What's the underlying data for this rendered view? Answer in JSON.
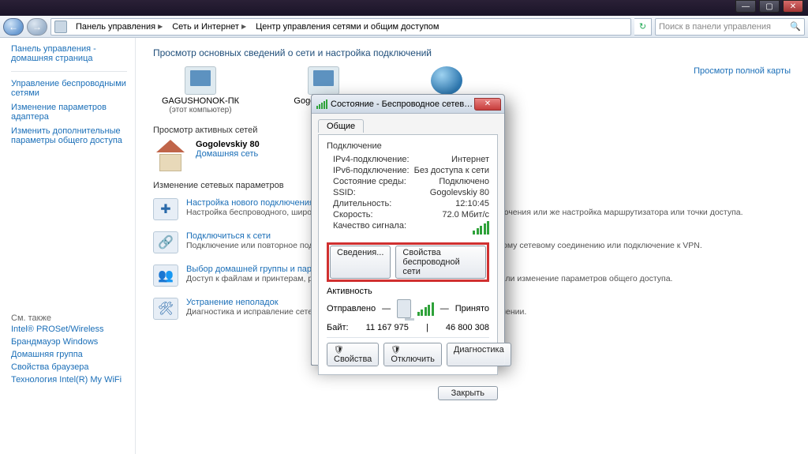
{
  "titlebar": {
    "min": "—",
    "max": "▢",
    "close": "✕"
  },
  "nav": {
    "back": "←",
    "fwd": "→",
    "refresh": "↻"
  },
  "breadcrumbs": [
    {
      "label": "Панель управления"
    },
    {
      "label": "Сеть и Интернет"
    },
    {
      "label": "Центр управления сетями и общим доступом"
    }
  ],
  "search": {
    "placeholder": "Поиск в панели управления"
  },
  "sidebar": {
    "home": "Панель управления - домашняя страница",
    "nav": [
      "Управление беспроводными сетями",
      "Изменение параметров адаптера",
      "Изменить дополнительные параметры общего доступа"
    ],
    "see_also_label": "См. также",
    "see_also": [
      "Intel® PROSet/Wireless",
      "Брандмауэр Windows",
      "Домашняя группа",
      "Свойства браузера",
      "Технология Intel(R) My WiFi"
    ]
  },
  "main": {
    "heading": "Просмотр основных сведений о сети и настройка подключений",
    "map": {
      "pc_name": "GAGUSHONOK-ПК",
      "pc_sub": "(этот компьютер)",
      "router": "Gogolevskiy 80",
      "internet": "Интернет",
      "full_map": "Просмотр полной карты"
    },
    "active_head": "Просмотр активных сетей",
    "active": {
      "name": "Gogolevskiy 80",
      "type": "Домашняя сеть"
    },
    "params_head": "Изменение сетевых параметров",
    "params": [
      {
        "title": "Настройка нового подключения или сети",
        "sub": "Настройка беспроводного, широкополосного, модемного, прямого или VPN-подключения или же настройка маршрутизатора или точки доступа."
      },
      {
        "title": "Подключиться к сети",
        "sub": "Подключение или повторное подключение к беспроводному, проводному, модемному сетевому соединению или подключение к VPN."
      },
      {
        "title": "Выбор домашней группы и параметров общего доступа",
        "sub": "Доступ к файлам и принтерам, расположенным на других сетевых компьютерах, или изменение параметров общего доступа."
      },
      {
        "title": "Устранение неполадок",
        "sub": "Диагностика и исправление сетевых проблем или получение сведений об исправлении."
      }
    ]
  },
  "dlg": {
    "title": "Состояние - Беспроводное сетевое соединение",
    "close": "✕",
    "tab": "Общие",
    "conn_label": "Подключение",
    "rows": {
      "ipv4_k": "IPv4-подключение:",
      "ipv4_v": "Интернет",
      "ipv6_k": "IPv6-подключение:",
      "ipv6_v": "Без доступа к сети",
      "media_k": "Состояние среды:",
      "media_v": "Подключено",
      "ssid_k": "SSID:",
      "ssid_v": "Gogolevskiy 80",
      "dur_k": "Длительность:",
      "dur_v": "12:10:45",
      "speed_k": "Скорость:",
      "speed_v": "72.0 Мбит/с",
      "sig_k": "Качество сигнала:"
    },
    "btn_details": "Сведения...",
    "btn_wprops": "Свойства беспроводной сети",
    "activity_label": "Активность",
    "sent": "Отправлено",
    "recv": "Принято",
    "bytes_label": "Байт:",
    "bytes_sent": "11 167 975",
    "bytes_recv": "46 800 308",
    "btn_props": "Свойства",
    "btn_disable": "Отключить",
    "btn_diag": "Диагностика",
    "btn_close": "Закрыть"
  }
}
